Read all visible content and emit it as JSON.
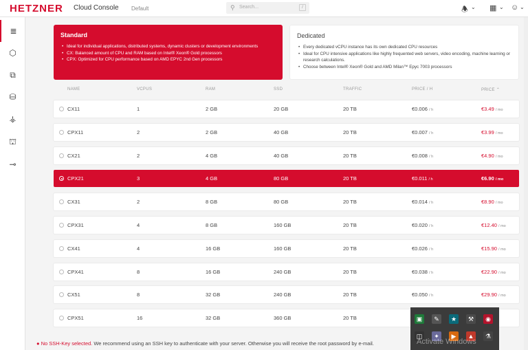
{
  "header": {
    "logo": "HETZNER",
    "app_title": "Cloud Console",
    "project": "Default",
    "search_placeholder": "Search...",
    "search_shortcut": "/",
    "bell_chevron": "⌄",
    "apps_chevron": "⌄",
    "user_chevron": "⌄"
  },
  "sidebar": {
    "items": [
      {
        "name": "servers",
        "icon": "≣"
      },
      {
        "name": "volumes",
        "icon": "⬡"
      },
      {
        "name": "networks",
        "icon": "⧉"
      },
      {
        "name": "load-balancers",
        "icon": "⛁"
      },
      {
        "name": "firewalls",
        "icon": "⚶"
      },
      {
        "name": "floating-ips",
        "icon": "⛫"
      },
      {
        "name": "security",
        "icon": "⊸"
      }
    ]
  },
  "plans": {
    "standard": {
      "title": "Standard",
      "bullets": [
        "Ideal for individual applications, distributed systems, dynamic clusters or development environments",
        "CX: Balanced amount of CPU and RAM based on Intel® Xeon® Gold processors",
        "CPX: Optimized for CPU performance based on AMD EPYC 2nd Gen processors"
      ]
    },
    "dedicated": {
      "title": "Dedicated",
      "bullets": [
        "Every dedicated vCPU instance has its own dedicated CPU resources",
        "Ideal for CPU intensive applications like highly frequented web servers, video encoding, machine learning or research calculations.",
        "Choose between Intel® Xeon® Gold and AMD Milan™ Epyc 7003 processors"
      ]
    }
  },
  "table": {
    "headers": {
      "name": "NAME",
      "vcpus": "VCPUS",
      "ram": "RAM",
      "ssd": "SSD",
      "traffic": "TRAFFIC",
      "price_h": "PRICE / H",
      "price": "PRICE",
      "sort_icon": "⌃"
    },
    "hour_unit": "/ h",
    "month_unit": "/ mo",
    "rows": [
      {
        "name": "CX11",
        "vcpus": "1",
        "ram": "2 GB",
        "ssd": "20 GB",
        "traffic": "20 TB",
        "price_h": "€0.006",
        "price": "€3.49",
        "selected": false
      },
      {
        "name": "CPX11",
        "vcpus": "2",
        "ram": "2 GB",
        "ssd": "40 GB",
        "traffic": "20 TB",
        "price_h": "€0.007",
        "price": "€3.99",
        "selected": false
      },
      {
        "name": "CX21",
        "vcpus": "2",
        "ram": "4 GB",
        "ssd": "40 GB",
        "traffic": "20 TB",
        "price_h": "€0.008",
        "price": "€4.90",
        "selected": false
      },
      {
        "name": "CPX21",
        "vcpus": "3",
        "ram": "4 GB",
        "ssd": "80 GB",
        "traffic": "20 TB",
        "price_h": "€0.011",
        "price": "€6.90",
        "selected": true
      },
      {
        "name": "CX31",
        "vcpus": "2",
        "ram": "8 GB",
        "ssd": "80 GB",
        "traffic": "20 TB",
        "price_h": "€0.014",
        "price": "€8.90",
        "selected": false
      },
      {
        "name": "CPX31",
        "vcpus": "4",
        "ram": "8 GB",
        "ssd": "160 GB",
        "traffic": "20 TB",
        "price_h": "€0.020",
        "price": "€12.40",
        "selected": false
      },
      {
        "name": "CX41",
        "vcpus": "4",
        "ram": "16 GB",
        "ssd": "160 GB",
        "traffic": "20 TB",
        "price_h": "€0.026",
        "price": "€15.90",
        "selected": false
      },
      {
        "name": "CPX41",
        "vcpus": "8",
        "ram": "16 GB",
        "ssd": "240 GB",
        "traffic": "20 TB",
        "price_h": "€0.038",
        "price": "€22.90",
        "selected": false
      },
      {
        "name": "CX51",
        "vcpus": "8",
        "ram": "32 GB",
        "ssd": "240 GB",
        "traffic": "20 TB",
        "price_h": "€0.050",
        "price": "€29.90",
        "selected": false
      },
      {
        "name": "CPX51",
        "vcpus": "16",
        "ram": "32 GB",
        "ssd": "360 GB",
        "traffic": "20 TB",
        "price_h": "",
        "price": "",
        "selected": false
      }
    ]
  },
  "warning": {
    "bold": "No SSH-Key selected.",
    "text": " We recommend using an SSH key to authenticate with your server. Otherwise you will receive the root password by e-mail."
  },
  "tray": {
    "activate_text": "Activate Windows",
    "icons": [
      "tray-icon-1",
      "tray-icon-2",
      "tray-icon-3",
      "tray-icon-4",
      "tray-icon-5",
      "tray-icon-6",
      "tray-icon-7",
      "tray-icon-8",
      "tray-icon-9",
      "tray-icon-10"
    ]
  }
}
